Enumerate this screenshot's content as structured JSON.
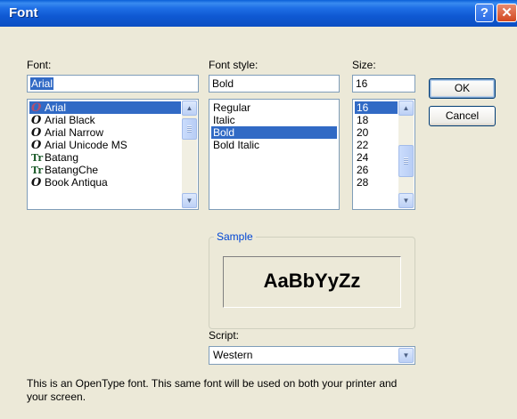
{
  "window": {
    "title": "Font",
    "help_glyph": "?",
    "close_glyph": "✕"
  },
  "font": {
    "label": "Font:",
    "value": "Arial",
    "items": [
      {
        "icon": "opentype-icon",
        "glyph": "O",
        "label": "Arial",
        "selected": true
      },
      {
        "icon": "opentype-icon",
        "glyph": "O",
        "label": "Arial Black"
      },
      {
        "icon": "opentype-icon",
        "glyph": "O",
        "label": "Arial Narrow"
      },
      {
        "icon": "opentype-icon",
        "glyph": "O",
        "label": "Arial Unicode MS"
      },
      {
        "icon": "truetype-icon",
        "glyph": "Tr",
        "label": "Batang"
      },
      {
        "icon": "truetype-icon",
        "glyph": "Tr",
        "label": "BatangChe"
      },
      {
        "icon": "opentype-icon",
        "glyph": "O",
        "label": "Book Antiqua"
      }
    ]
  },
  "style": {
    "label": "Font style:",
    "value": "Bold",
    "items": [
      {
        "label": "Regular"
      },
      {
        "label": "Italic"
      },
      {
        "label": "Bold",
        "selected": true
      },
      {
        "label": "Bold Italic"
      }
    ]
  },
  "size": {
    "label": "Size:",
    "value": "16",
    "items": [
      {
        "label": "16",
        "selected": true
      },
      {
        "label": "18"
      },
      {
        "label": "20"
      },
      {
        "label": "22"
      },
      {
        "label": "24"
      },
      {
        "label": "26"
      },
      {
        "label": "28"
      }
    ]
  },
  "buttons": {
    "ok": "OK",
    "cancel": "Cancel"
  },
  "sample": {
    "label": "Sample",
    "text": "AaBbYyZz"
  },
  "script": {
    "label": "Script:",
    "value": "Western"
  },
  "description": "This is an OpenType font. This same font will be used on both your printer and your screen.",
  "colors": {
    "title_bar": "#0b4ec2",
    "selection": "#316ac5",
    "dialog_bg": "#ece9d8",
    "group_label": "#0046d5"
  },
  "icons": {
    "scroll_up": "▲",
    "scroll_down": "▼",
    "combo_arrow": "▼"
  }
}
